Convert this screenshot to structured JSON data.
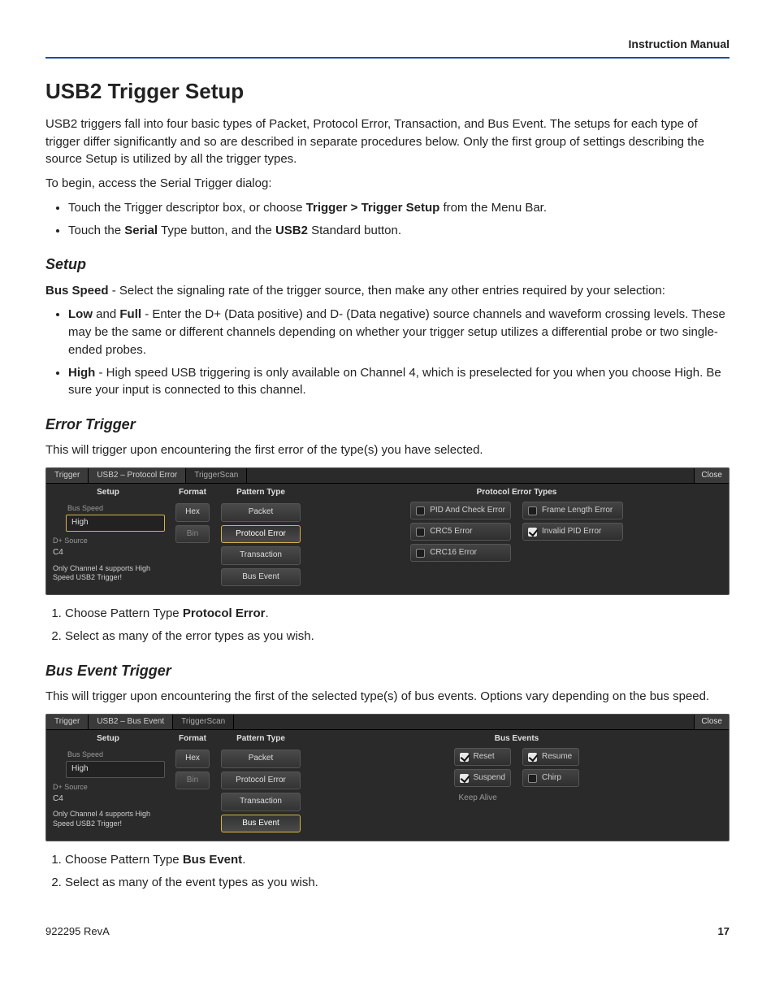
{
  "header": {
    "running": "Instruction Manual"
  },
  "title": "USB2 Trigger Setup",
  "intro": "USB2 triggers fall into four basic types of Packet, Protocol Error, Transaction, and Bus Event. The setups for each type of trigger differ significantly and so are described in separate procedures below. Only the first group of settings describing the source Setup is utilized by all the trigger types.",
  "begin_line": "To begin, access the Serial Trigger dialog:",
  "begin_bullets": {
    "b1_pre": "Touch the Trigger descriptor box, or choose ",
    "b1_bold": "Trigger > Trigger Setup",
    "b1_post": " from the Menu Bar.",
    "b2_pre": "Touch the ",
    "b2_bold1": "Serial",
    "b2_mid": " Type button, and the ",
    "b2_bold2": "USB2",
    "b2_post": " Standard button."
  },
  "setup": {
    "heading": "Setup",
    "lead_bold": "Bus Speed",
    "lead_rest": " - Select the signaling rate of the trigger source, then make any other entries required by your selection:",
    "bullet1_bold1": "Low",
    "bullet1_mid": " and ",
    "bullet1_bold2": "Full",
    "bullet1_rest": " - Enter the D+ (Data positive) and D- (Data negative) source channels and waveform crossing levels. These may be the same or different channels depending on whether your trigger setup utilizes a differential probe or two single-ended probes.",
    "bullet2_bold": "High",
    "bullet2_rest": " - High speed USB triggering is only available on Channel 4, which is preselected for you when you choose High. Be sure your input is connected to this channel."
  },
  "error_trigger": {
    "heading": "Error Trigger",
    "lead": "This will trigger upon encountering the first error of the type(s) you have selected.",
    "step1_pre": "Choose Pattern Type ",
    "step1_bold": "Protocol Error",
    "step1_post": ".",
    "step2": "Select as many of the error types as you wish."
  },
  "bus_event_trigger": {
    "heading": "Bus Event Trigger",
    "lead": "This will trigger upon encountering the first of the selected type(s) of bus events. Options vary depending on the bus speed.",
    "step1_pre": "Choose Pattern Type ",
    "step1_bold": "Bus Event",
    "step1_post": ".",
    "step2": "Select as many of the event types as you wish."
  },
  "panel_common": {
    "close": "Close",
    "tabs": {
      "trigger": "Trigger",
      "scan": "TriggerScan"
    },
    "headers": {
      "setup": "Setup",
      "format": "Format",
      "pattern": "Pattern Type"
    },
    "labels": {
      "bus_speed": "Bus Speed",
      "d_plus_source": "D+ Source"
    },
    "values": {
      "bus_speed": "High",
      "d_plus_source": "C4"
    },
    "note": "Only Channel 4 supports High Speed USB2 Trigger!",
    "format_buttons": {
      "hex": "Hex",
      "bin": "Bin"
    },
    "pattern_buttons": {
      "packet": "Packet",
      "protocol_error": "Protocol Error",
      "transaction": "Transaction",
      "bus_event": "Bus Event"
    }
  },
  "panel1": {
    "tab_middle": "USB2 – Protocol Error",
    "options_header": "Protocol Error Types",
    "opts": {
      "pid_and_check": "PID And Check Error",
      "frame_length": "Frame Length Error",
      "crc5": "CRC5 Error",
      "invalid_pid": "Invalid PID Error",
      "crc16": "CRC16 Error"
    }
  },
  "panel2": {
    "tab_middle": "USB2 – Bus Event",
    "options_header": "Bus Events",
    "opts": {
      "reset": "Reset",
      "resume": "Resume",
      "suspend": "Suspend",
      "chirp": "Chirp",
      "keep_alive": "Keep Alive"
    }
  },
  "footer": {
    "doc": "922295 RevA",
    "page": "17"
  }
}
